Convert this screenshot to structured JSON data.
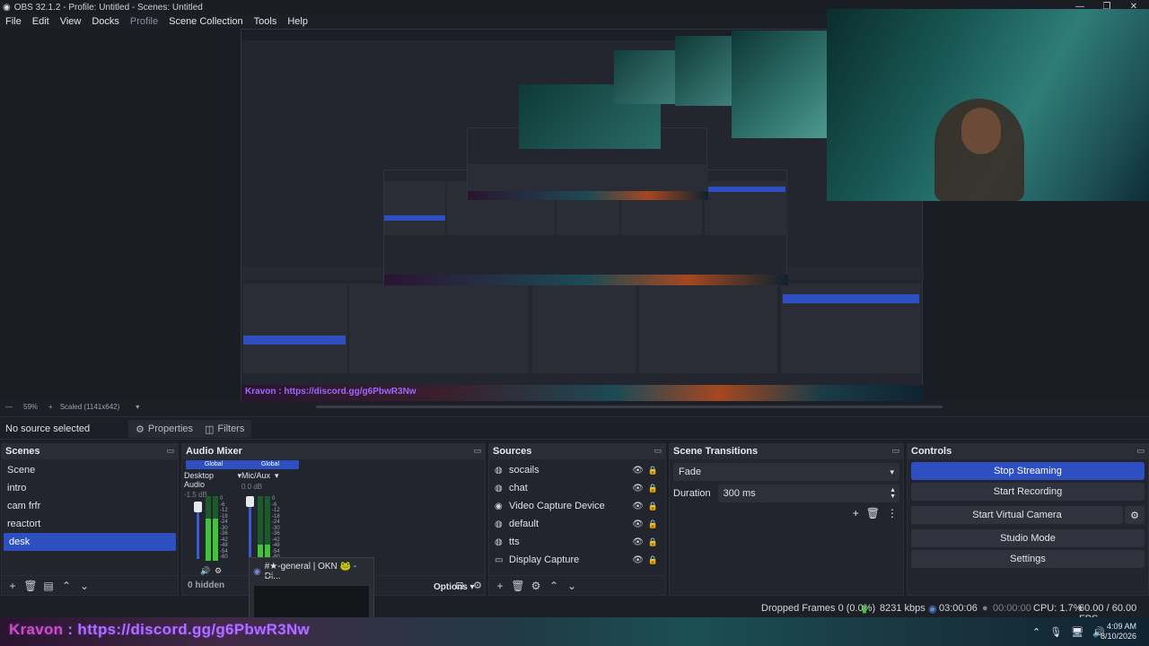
{
  "window": {
    "title": "OBS 32.1.2 - Profile: Untitled - Scenes: Untitled"
  },
  "menu": [
    "File",
    "Edit",
    "View",
    "Docks",
    "Profile",
    "Scene Collection",
    "Tools",
    "Help"
  ],
  "zoom": {
    "percent": "59%",
    "mode": "Scaled (1141x642)"
  },
  "source_bar": {
    "selected": "No source selected",
    "properties": "Properties",
    "filters": "Filters"
  },
  "scenes": {
    "title": "Scenes",
    "items": [
      "Scene",
      "intro",
      "cam frfr",
      "reactort",
      "desk"
    ],
    "selected_index": 4
  },
  "audio_mixer": {
    "title": "Audio Mixer",
    "channels": [
      {
        "badge": "Global",
        "name": "Desktop Audio",
        "db": "-1.5 dB",
        "level": 0.65
      },
      {
        "badge": "Global",
        "name": "Mic/Aux",
        "db": "0.0 dB",
        "level": 0.25
      }
    ],
    "scale": [
      "0",
      "-6",
      "-12",
      "-18",
      "-24",
      "-30",
      "-36",
      "-42",
      "-48",
      "-54",
      "-60"
    ],
    "hidden": "0 hidden",
    "popup": "#★-general | OKN 🐸 - Di..."
  },
  "sources": {
    "title": "Sources",
    "items": [
      {
        "name": "socails",
        "icon": "globe-icon"
      },
      {
        "name": "chat",
        "icon": "globe-icon"
      },
      {
        "name": "Video Capture Device",
        "icon": "camera-icon"
      },
      {
        "name": "default",
        "icon": "globe-icon"
      },
      {
        "name": "tts",
        "icon": "globe-icon"
      },
      {
        "name": "Display Capture",
        "icon": "monitor-icon"
      }
    ],
    "options_label": "Options"
  },
  "transitions": {
    "title": "Scene Transitions",
    "selected": "Fade",
    "duration_label": "Duration",
    "duration_value": "300 ms"
  },
  "controls": {
    "title": "Controls",
    "buttons": [
      "Stop Streaming",
      "Start Recording",
      "Start Virtual Camera",
      "Studio Mode",
      "Settings"
    ]
  },
  "status": {
    "dropped": "Dropped Frames 0 (0.0%)",
    "kbps": "8231 kbps",
    "stream_time": "03:00:06",
    "rec_time": "00:00:00",
    "cpu": "CPU: 1.7%",
    "fps": "60.00 / 60.00 FPS"
  },
  "taskbar": {
    "chat_user": "Kravon",
    "chat_text": "https://discord.gg/g6PbwR3Nw",
    "time": "4:09 AM",
    "date": "8/10/2026"
  },
  "colors": {
    "accent": "#2d4fc1",
    "panel": "#22252d",
    "background": "#1d1f26"
  }
}
